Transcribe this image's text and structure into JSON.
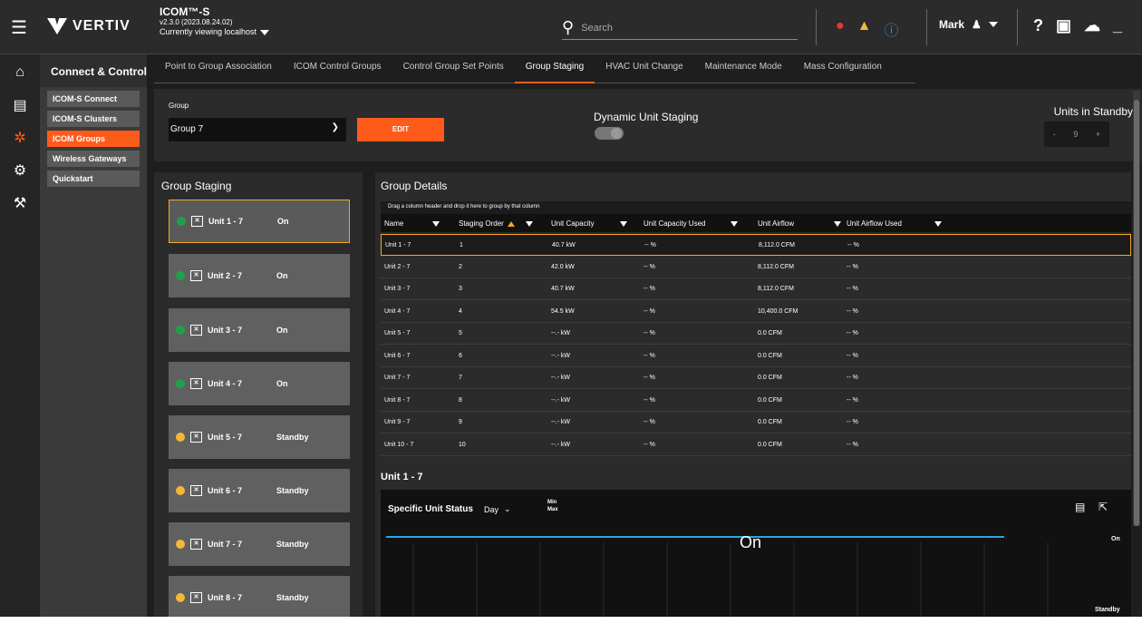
{
  "brand": {
    "name": "VERTIV",
    "tm": "™"
  },
  "app": {
    "title": "ICOM™-S",
    "version": "v2.3.0 (2023.08.24.02)",
    "viewing": "Currently viewing localhost"
  },
  "search": {
    "placeholder": "Search"
  },
  "user": {
    "name": "Mark"
  },
  "sidenav": {
    "header": "Connect & Control",
    "items": [
      "ICOM-S Connect",
      "ICOM-S Clusters",
      "ICOM Groups",
      "Wireless Gateways",
      "Quickstart"
    ]
  },
  "tabs": [
    "Point to Group Association",
    "ICOM Control Groups",
    "Control Group Set Points",
    "Group Staging",
    "HVAC Unit Change",
    "Maintenance Mode",
    "Mass Configuration"
  ],
  "controls": {
    "group_label": "Group",
    "group_value": "Group 7",
    "edit_label": "EDIT",
    "dynamic_label": "Dynamic Unit Staging",
    "standby_label": "Units in Standby",
    "standby_minus": "-",
    "standby_value": "9",
    "standby_plus": "+"
  },
  "staging": {
    "title": "Group Staging",
    "units": [
      {
        "name": "Unit 1 - 7",
        "status": "On"
      },
      {
        "name": "Unit 2 - 7",
        "status": "On"
      },
      {
        "name": "Unit 3 - 7",
        "status": "On"
      },
      {
        "name": "Unit 4 - 7",
        "status": "On"
      },
      {
        "name": "Unit 5 - 7",
        "status": "Standby"
      },
      {
        "name": "Unit 6 - 7",
        "status": "Standby"
      },
      {
        "name": "Unit 7 - 7",
        "status": "Standby"
      },
      {
        "name": "Unit 8 - 7",
        "status": "Standby"
      }
    ]
  },
  "details": {
    "title": "Group Details",
    "drag_hint": "Drag a column header and drop it here to group by that column",
    "columns": [
      "Name",
      "Staging Order",
      "Unit Capacity",
      "Unit Capacity Used",
      "Unit Airflow",
      "Unit Airflow Used"
    ],
    "rows": [
      [
        "Unit 1 - 7",
        "1",
        "40.7 kW",
        "-- %",
        "8,112.0 CFM",
        "-- %"
      ],
      [
        "Unit 2 - 7",
        "2",
        "42.0 kW",
        "-- %",
        "8,112.0 CFM",
        "-- %"
      ],
      [
        "Unit 3 - 7",
        "3",
        "40.7 kW",
        "-- %",
        "8,112.0 CFM",
        "-- %"
      ],
      [
        "Unit 4 - 7",
        "4",
        "54.5 kW",
        "-- %",
        "10,400.0 CFM",
        "-- %"
      ],
      [
        "Unit 5 - 7",
        "5",
        "--.- kW",
        "-- %",
        "0.0 CFM",
        "-- %"
      ],
      [
        "Unit 6 - 7",
        "6",
        "--.- kW",
        "-- %",
        "0.0 CFM",
        "-- %"
      ],
      [
        "Unit 7 - 7",
        "7",
        "--.- kW",
        "-- %",
        "0.0 CFM",
        "-- %"
      ],
      [
        "Unit 8 - 7",
        "8",
        "--.- kW",
        "-- %",
        "0.0 CFM",
        "-- %"
      ],
      [
        "Unit 9 - 7",
        "9",
        "--.- kW",
        "-- %",
        "0.0 CFM",
        "-- %"
      ],
      [
        "Unit 10 - 7",
        "10",
        "--.- kW",
        "-- %",
        "0.0 CFM",
        "-- %"
      ]
    ]
  },
  "unit_panel": {
    "title": "Unit 1 - 7",
    "status_label": "Specific Unit Status",
    "range": "Day",
    "min": "Min",
    "max": "Max",
    "chart_on": "On",
    "axis_on": "On",
    "axis_standby": "Standby"
  },
  "colors": {
    "accent": "#fe5b1b",
    "on": "#21a04a",
    "standby": "#f5b73a",
    "line": "#2aa7e0"
  }
}
